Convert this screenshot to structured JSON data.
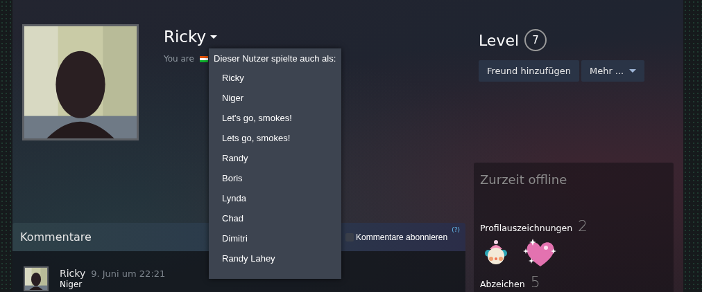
{
  "profile": {
    "name": "Ricky",
    "location_label": "You are"
  },
  "alias_menu": {
    "title": "Dieser Nutzer spielte auch als:",
    "items": [
      "Ricky",
      "Niger",
      "Let's go, smokes!",
      "Lets go, smokes!",
      "Randy",
      "Boris",
      "Lynda",
      "Chad",
      "Dimitri",
      "Randy Lahey"
    ]
  },
  "level": {
    "label": "Level",
    "value": "7"
  },
  "actions": [
    {
      "label": "Freund hinzufügen",
      "kind": "button"
    },
    {
      "label": "Mehr ...",
      "kind": "dropdown"
    }
  ],
  "status": {
    "text": "Zurzeit offline"
  },
  "awards": {
    "label": "Profilauszeichnungen",
    "count": "2"
  },
  "badges": {
    "label": "Abzeichen",
    "count": "5"
  },
  "comments": {
    "title": "Kommentare",
    "subscribe": {
      "label": "Kommentare abonnieren",
      "checked": false
    },
    "help": "(?)",
    "items": [
      {
        "author": "Ricky",
        "time": "9. Juni um 22:21",
        "text": "Niger"
      }
    ]
  }
}
